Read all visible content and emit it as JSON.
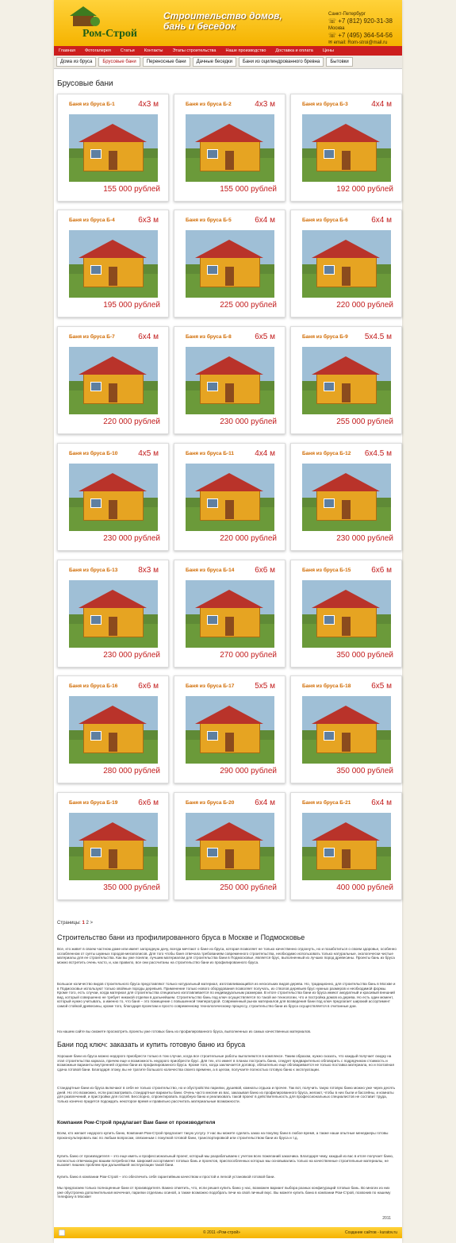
{
  "header": {
    "logo_name": "Ром-Строй",
    "slogan": "Строительство домов, бань и беседок",
    "spb_city": "Санкт-Петербург",
    "spb_phone": "+7 (812) 920-31-38",
    "msk_city": "Москва",
    "msk_phone": "+7 (495) 364-54-56",
    "email": "email: Rom-stroi@mail.ru"
  },
  "top_menu": [
    "Главная",
    "Фотогалерея",
    "Статьи",
    "Контакты",
    "Этапы строительства",
    "Наше производство",
    "Доставка и оплата",
    "Цены"
  ],
  "sub_menu": [
    "Дома из бруса",
    "Брусовые бани",
    "Переносные бани",
    "Дачные беседки",
    "Бани из оцилиндрованного бревна",
    "Бытовки"
  ],
  "page_title": "Брусовые бани",
  "products": [
    {
      "name": "Баня из бруса Б-1",
      "size": "4x3 м",
      "price": "155 000 рублей"
    },
    {
      "name": "Баня из бруса Б-2",
      "size": "4x3 м",
      "price": "155 000 рублей"
    },
    {
      "name": "Баня из бруса Б-3",
      "size": "4x4 м",
      "price": "192 000 рублей"
    },
    {
      "name": "Баня из бруса Б-4",
      "size": "6x3 м",
      "price": "195 000 рублей"
    },
    {
      "name": "Баня из бруса Б-5",
      "size": "6x4 м",
      "price": "225 000 рублей"
    },
    {
      "name": "Баня из бруса Б-6",
      "size": "6x4 м",
      "price": "220 000 рублей"
    },
    {
      "name": "Баня из бруса Б-7",
      "size": "6x4 м",
      "price": "220 000 рублей"
    },
    {
      "name": "Баня из бруса Б-8",
      "size": "6x5 м",
      "price": "230 000 рублей"
    },
    {
      "name": "Баня из бруса Б-9",
      "size": "5x4.5 м",
      "price": "255 000 рублей"
    },
    {
      "name": "Баня из бруса Б-10",
      "size": "4x5 м",
      "price": "230 000 рублей"
    },
    {
      "name": "Баня из бруса Б-11",
      "size": "4x4 м",
      "price": "220 000 рублей"
    },
    {
      "name": "Баня из бруса Б-12",
      "size": "6x4.5 м",
      "price": "230 000 рублей"
    },
    {
      "name": "Баня из бруса Б-13",
      "size": "8x3 м",
      "price": "230 000 рублей"
    },
    {
      "name": "Баня из бруса Б-14",
      "size": "6x6 м",
      "price": "270 000 рублей"
    },
    {
      "name": "Баня из бруса Б-15",
      "size": "6x6 м",
      "price": "350 000 рублей"
    },
    {
      "name": "Баня из бруса Б-16",
      "size": "6x6 м",
      "price": "280 000 рублей"
    },
    {
      "name": "Баня из бруса Б-17",
      "size": "5x5 м",
      "price": "290 000 рублей"
    },
    {
      "name": "Баня из бруса Б-18",
      "size": "6x5 м",
      "price": "350 000 рублей"
    },
    {
      "name": "Баня из бруса Б-19",
      "size": "6x6 м",
      "price": "350 000 рублей"
    },
    {
      "name": "Баня из бруса Б-20",
      "size": "6x4 м",
      "price": "250 000 рублей"
    },
    {
      "name": "Баня из бруса Б-21",
      "size": "6x4 м",
      "price": "400 000 рублей"
    }
  ],
  "pager": {
    "label": "Страницы:",
    "current": "1",
    "next": "2",
    "arrow": ">"
  },
  "article": {
    "h2_1": "Строительство бани из профилированного бруса в Москве и Подмосковье",
    "p1": "Все, кто живет в своем частном доме или имеет загородную дачу, всегда мечтают о бане из бруса, которая позволяет не только качественно отдохнуть, но и позаботиться о своем здоровье, особенно ослабленном от суеты шумных городов-мегаполисов. Для того чтобы баня отвечала требованиям современного строительства, необходимо использовать только натуральные, экологически чистые материалы для ее строительства. Как вы уже поняли, лучшим материалом для строительства бани в Подмосковье, является брус, выполненный из лучших пород древесины. Проекты бань из бруса можно встретить очень часто, и, как правило, все они рассчитаны на строительство бани из профилированного бруса.",
    "p2": "Большое количество видов строительного бруса представляют только натуральный материал, изготавливающийся из нескольких видов дерева. Но, традиционно, для строительства бань в Москве и в Подмосковье используют только хвойные породы деревьев. Применение только нового оборудования позволяет получать, из стволов деревьев брус нужных размеров и необходимой формы. Кроме того, есть случаи, когда материал для строительства специально изготавливается по индивидуальным размерам. В итоге строительства бани из бруса имеют аккуратный и красивый внешний вид, который совершенно не требует никакой отделки в дальнейшем. Строительство бань под ключ осуществляется по такой же технологии, что и постройка домов из дерева. Но есть один момент, который нужно учитывать, а именно то, что баня – это помещение с повышенной температурой. Современный рынок материалов для возведения бани под ключ предлагает широкий ассортимент самой стойкой древесины, кроме того, благодаря проектам и просто современному технологическому процессу, строительство бани из бруса осуществляется в считанные дни.",
    "p3": "На нашем сайте вы сможете просмотреть проекты уже готовых бань из профилированного бруса, выполненных из самых качественных материалов.",
    "h2_2": "Бани под ключ: заказать и купить готовую баню из бруса",
    "p4": "Хорошие бани из бруса можно недорого приобрести только в том случае, когда все строительные работы выполняются в комплексе. Таким образом, нужно сказать, что каждый получает скидку на этап строительства каркаса, причем еще и возможность недорого приобрести брус. Для тех, кто имеет в планах построить баню, следует предварительно обговорить с подрядчиком стоимость и возможные варианты внутренней отделки бани из профилированного бруса. Кроме того, когда заключается договор, обязательно еще обговаривается не только поставка материала, но и поэтапная сдача готовой бани. Благодаря этому, вы не тратите большого количества своего времени, а в целом, получаете полностью готовую баню к эксплуатации.",
    "p5": "Стандартные бани из бруса включают в себя не только строительство, но и обустройство парилки, душевой, комнаты отдыха и прочее. Так вот, получить такую готовую баню можно уже через десять дней. Но это возможно, если рассматривать стандартные варианты бани. Очень часто многие из вас, заказывая баню из профилированного бруса, желают, чтобы в них были и бассейны, и комнаты для развлечений, и пристройки для гостей. Бесспорно, спроектировать подобную баню и реализовать такой проект в действительность для профессиональных специалистов не составит труда, только конечно придется подождать некоторое время и правильно рассчитать материальные возможности.",
    "h3": "Компания Ром-Строй предлагает Вам бани от производителя",
    "p6": "Всем, кто желает недорого купить баню, Компания Ром-Строй предлагает такую услугу. У нас вы можете сделать заказ на покупку бани в любое время, а также наши опытные менеджеры готовы проконсультировать вас по любым вопросам, связанным с покупкой готовой бани, транспортировкой или строительством бани из бруса и т.д.",
    "p7": "Купить баню от производителя – это еще иметь и профессиональный проект, который мы разрабатываем с учетом всех пожеланий заказчика. Благодаря чему, каждый из вас в итоге получает баню, полностью отвечающую вашим потребностям. Широкий ассортимент готовых бань и проектов, приспособленных которых мы основывались только на качественные строительные материалы, не вызовет лишних проблем при дальнейшей эксплуатации такой бани.",
    "p8": "Купить баню в компании Ром-Строй – это обеспечить себя гарантийным качеством и простой и легкой установкой готовой бани.",
    "p9": "Мы предлагаем только полноценные бани от производителя. Важно отметить, что, если решил купить баню у нас, возможен вариант выбора разных конфигураций готовых бань. Во многих из них уже обустроена дополнительная мочечная, парилки отделаны осиной, а также возможно подобрать печи на свой личный вкус. Вы можете купить баню в компании Ром-Строй, позвонив по нашему телефону в Москве!"
  },
  "year": "2011",
  "footer": {
    "copyright": "© 2011 «Ром-строй»",
    "dev": "Создание сайтов - kuratov.ru"
  },
  "colors": {
    "accent_red": "#c21c1c",
    "header_yellow": "#f5b300",
    "name_orange": "#d06a00"
  }
}
